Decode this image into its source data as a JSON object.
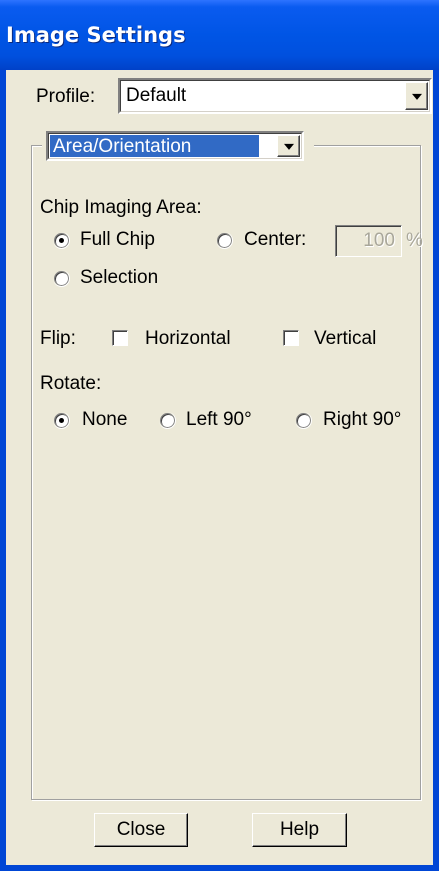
{
  "window": {
    "title": "Image Settings"
  },
  "profile": {
    "label": "Profile:",
    "value": "Default"
  },
  "section_selector": {
    "value": "Area/Orientation"
  },
  "chip_area": {
    "label": "Chip Imaging Area:",
    "options": [
      {
        "label": "Full Chip",
        "checked": true
      },
      {
        "label": "Center:",
        "checked": false
      },
      {
        "label": "Selection",
        "checked": false
      }
    ],
    "center_percent": "100",
    "percent_unit": "%"
  },
  "flip": {
    "label": "Flip:",
    "horizontal_label": "Horizontal",
    "horizontal_checked": false,
    "vertical_label": "Vertical",
    "vertical_checked": false
  },
  "rotate": {
    "label": "Rotate:",
    "options": [
      {
        "label": "None",
        "checked": true
      },
      {
        "label": "Left 90°",
        "checked": false
      },
      {
        "label": "Right 90°",
        "checked": false
      }
    ]
  },
  "buttons": {
    "close": "Close",
    "help": "Help"
  },
  "colors": {
    "titlebar": "#0055e5",
    "dialog_bg": "#ece9d8",
    "selection": "#316ac5"
  }
}
